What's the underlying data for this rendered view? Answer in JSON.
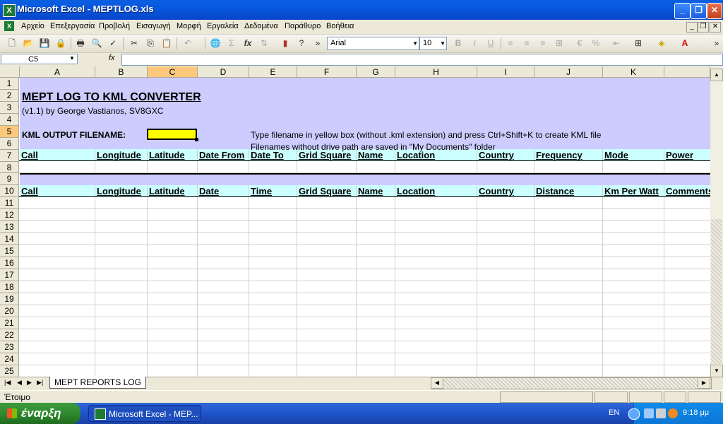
{
  "window": {
    "title": "Microsoft Excel - MEPTLOG.xls"
  },
  "menu": [
    "Αρχείο",
    "Επεξεργασία",
    "Προβολή",
    "Εισαγωγή",
    "Μορφή",
    "Εργαλεία",
    "Δεδομένα",
    "Παράθυρο",
    "Βοήθεια"
  ],
  "toolbar": {
    "font": "Arial",
    "size": "10",
    "bold": "B",
    "italic": "I",
    "underline": "U",
    "sum": "Σ",
    "percent": "%"
  },
  "formula_bar": {
    "name_box": "C5",
    "fx": "fx",
    "value": ""
  },
  "columns": [
    "A",
    "B",
    "C",
    "D",
    "E",
    "F",
    "G",
    "H",
    "I",
    "J",
    "K"
  ],
  "rows": [
    "1",
    "2",
    "3",
    "4",
    "5",
    "6",
    "7",
    "8",
    "9",
    "10",
    "11",
    "12",
    "13",
    "14",
    "15",
    "16",
    "17",
    "18",
    "19",
    "20",
    "21",
    "22",
    "23",
    "24",
    "25"
  ],
  "sheet": {
    "title": "MEPT LOG TO KML CONVERTER",
    "author": "(v1.1) by George Vastianos, SV8GXC",
    "output_label": "KML OUTPUT FILENAME:",
    "output_value": "",
    "instruction1": "Type filename in yellow box (without .kml extension) and press Ctrl+Shift+K to create KML file",
    "instruction2": "Filenames without drive path are saved in \"My Documents\" folder",
    "header_row7": [
      "Call",
      "Longitude",
      "Latitude",
      "Date From",
      "Date To",
      "Grid Square",
      "Name",
      "Location",
      "Country",
      "Frequency",
      "Mode",
      "Power"
    ],
    "header_row10": [
      "Call",
      "Longitude",
      "Latitude",
      "Date",
      "Time",
      "Grid Square",
      "Name",
      "Location",
      "Country",
      "Distance",
      "Km Per Watt",
      "Comments"
    ]
  },
  "sheet_tab": "MEPT REPORTS LOG",
  "status": "Έτοιμο",
  "taskbar": {
    "start": "έναρξη",
    "task": "Microsoft Excel - MEP...",
    "lang": "EN",
    "clock": "9:18 μμ"
  },
  "colors": {
    "band": "#ccccff",
    "header": "#ccffff",
    "input": "#ffff00",
    "selected_header": "#fcc87c"
  }
}
